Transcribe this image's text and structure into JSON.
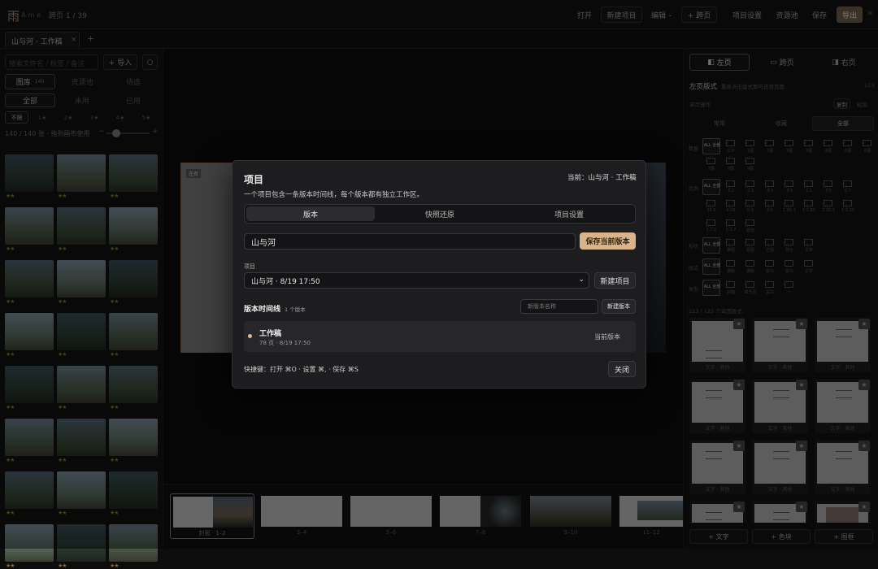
{
  "app": {
    "logo_char": "雨",
    "name": "Ame",
    "page_counter": "跨页 1 / 39"
  },
  "toolbar": {
    "open": "打开",
    "new_project": "新建项目",
    "edit": "编辑",
    "add_spread": "+ 跨页",
    "project_settings": "项目设置",
    "assets": "资源池",
    "save": "保存",
    "export": "导出",
    "close": "×"
  },
  "tabs": [
    {
      "label": "山与河 · 工作稿",
      "close": "×"
    }
  ],
  "tab_add": "+",
  "left": {
    "search_placeholder": "搜索文件名 / 标签 / 备注",
    "import": "+ 导入",
    "refresh": "○",
    "source_tabs": [
      "图库",
      "资源池",
      "待选"
    ],
    "library_count": "140",
    "filter_tabs": [
      "全部",
      "未用",
      "已用"
    ],
    "rating_tabs": [
      "不限",
      "1★",
      "2★",
      "3★",
      "4★",
      "5★"
    ],
    "summary": "140 / 140 张 · 拖到画布使用",
    "zoom_minus": "−",
    "zoom_plus": "+",
    "thumb_ratings": [
      "★★",
      "★★",
      "★★",
      "★★",
      "★★",
      "★★",
      "★★",
      "★★",
      "★★",
      "★★",
      "★★",
      "★★",
      "★★",
      "★★",
      "★★",
      "★★",
      "★★",
      "★★",
      "★★",
      "★★",
      "★★",
      "★★",
      "★★",
      "★★"
    ]
  },
  "canvas": {
    "page_label": "左页"
  },
  "filmstrip": {
    "captions": [
      "封面 · 1–2",
      "3–4",
      "5–6",
      "7–8",
      "9–10",
      "11–12"
    ]
  },
  "right": {
    "view_tabs": [
      "左页",
      "跨页",
      "右页"
    ],
    "section_title": "左页版式",
    "section_hint": "重新点击版式即可还原页面",
    "section_count": "123",
    "single_ops": "单页操作",
    "copy": "复制",
    "paste": "粘贴",
    "category_tabs": [
      "常用",
      "收藏",
      "全部"
    ],
    "groups": {
      "count": "数量",
      "ratio": "比例",
      "shape": "形状",
      "style": "版式",
      "type": "类型"
    },
    "count_opts": [
      "ALL 全部",
      "文字",
      "1图",
      "2图",
      "3图",
      "3图",
      "4图",
      "5图",
      "6图",
      "7图",
      "8图",
      "9图"
    ],
    "ratio_opts": [
      "ALL 全部",
      "3:2",
      "2:3",
      "4:3",
      "3:4",
      "1:1",
      "7:5",
      "5:7",
      "16:9",
      "9:16",
      "5:4",
      "4:5",
      "1.85:1",
      "1:1.85",
      "2.35:1",
      "1:2.35",
      "1.7:1",
      "1:2.7",
      "其他"
    ],
    "shape_opts": [
      "ALL 全部",
      "横图",
      "竖图",
      "方图",
      "混合",
      "文字"
    ],
    "style_opts": [
      "ALL 全部",
      "满版",
      "满版",
      "留白",
      "留白",
      "文字"
    ],
    "type_opts": [
      "ALL 全部",
      "封面",
      "章节页",
      "留白",
      "—"
    ],
    "list_summary": "123 / 123 个单页版式",
    "card_captions": [
      "文字 · 其他",
      "文字 · 其他",
      "文字 · 其他",
      "文字 · 其他",
      "文字 · 其他",
      "文字 · 其他",
      "文字 · 其他",
      "文字 · 其他",
      "文字 · 其他",
      "",
      "",
      ""
    ],
    "card_star": "★",
    "add_text": "+ 文字",
    "add_block": "+ 色块",
    "add_frame": "+ 图框"
  },
  "modal": {
    "title": "项目",
    "current": "当前：山与河 · 工作稿",
    "subtitle": "一个项目包含一条版本时间线，每个版本都有独立工作区。",
    "tabs": [
      "版本",
      "快照还原",
      "项目设置"
    ],
    "name_value": "山与河",
    "save_version": "保存当前版本",
    "project_label": "项目",
    "project_select": "山与河 · 8/19 17:50",
    "new_project": "新建项目",
    "timeline_title": "版本时间线",
    "timeline_count": "1 个版本",
    "version_name_placeholder": "新版本名称",
    "new_version": "新建版本",
    "version": {
      "name": "工作稿",
      "meta": "78 页 · 8/19 17:50",
      "status": "当前版本"
    },
    "shortcuts": "快捷键：打开 ⌘O · 设置 ⌘, · 保存 ⌘S",
    "close": "关闭"
  },
  "colors": {
    "accent": "#d9b48a",
    "dot": "#e0b98f",
    "background": "#0d0d0d",
    "modal": "#1d1d1f"
  }
}
